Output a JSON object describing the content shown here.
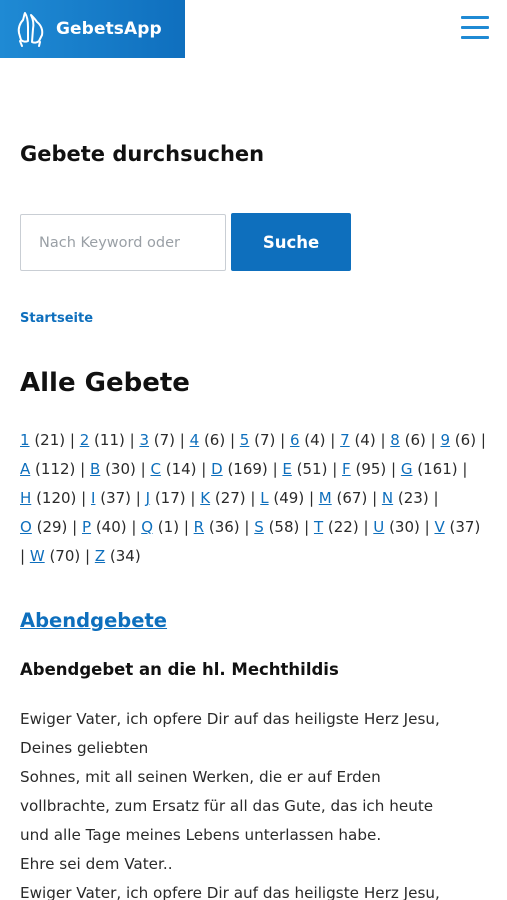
{
  "header": {
    "logo_text": "GebetsApp",
    "logo_icon": "praying-hands-icon",
    "menu_icon": "hamburger-menu-icon",
    "brand_color": "#1f8ad4"
  },
  "search": {
    "title": "Gebete durchsuchen",
    "placeholder": "Nach Keyword oder",
    "button_label": "Suche"
  },
  "breadcrumb": {
    "label": "Startseite"
  },
  "all_prayers": {
    "title": "Alle Gebete",
    "index": [
      {
        "letter": "1",
        "count": "(21)"
      },
      {
        "letter": "2",
        "count": "(11)"
      },
      {
        "letter": "3",
        "count": "(7)"
      },
      {
        "letter": "4",
        "count": "(6)"
      },
      {
        "letter": "5",
        "count": "(7)"
      },
      {
        "letter": "6",
        "count": "(4)"
      },
      {
        "letter": "7",
        "count": "(4)"
      },
      {
        "letter": "8",
        "count": "(6)"
      },
      {
        "letter": "9",
        "count": "(6)"
      },
      {
        "letter": "A",
        "count": "(112)"
      },
      {
        "letter": "B",
        "count": "(30)"
      },
      {
        "letter": "C",
        "count": "(14)"
      },
      {
        "letter": "D",
        "count": "(169)"
      },
      {
        "letter": "E",
        "count": "(51)"
      },
      {
        "letter": "F",
        "count": "(95)"
      },
      {
        "letter": "G",
        "count": "(161)"
      },
      {
        "letter": "H",
        "count": "(120)"
      },
      {
        "letter": "I",
        "count": "(37)"
      },
      {
        "letter": "J",
        "count": "(17)"
      },
      {
        "letter": "K",
        "count": "(27)"
      },
      {
        "letter": "L",
        "count": "(49)"
      },
      {
        "letter": "M",
        "count": "(67)"
      },
      {
        "letter": "N",
        "count": "(23)"
      },
      {
        "letter": "O",
        "count": "(29)"
      },
      {
        "letter": "P",
        "count": "(40)"
      },
      {
        "letter": "Q",
        "count": "(1)"
      },
      {
        "letter": "R",
        "count": "(36)"
      },
      {
        "letter": "S",
        "count": "(58)"
      },
      {
        "letter": "T",
        "count": "(22)"
      },
      {
        "letter": "U",
        "count": "(30)"
      },
      {
        "letter": "V",
        "count": "(37)"
      },
      {
        "letter": "W",
        "count": "(70)"
      },
      {
        "letter": "Z",
        "count": "(34)"
      }
    ]
  },
  "section": {
    "title": "Abendgebete",
    "prayer_title": "Abendgebet an die hl. Mechthildis",
    "prayer_lines": [
      "Ewiger Vater, ich opfere Dir auf das heiligste Herz Jesu,",
      "Deines geliebten",
      "Sohnes, mit all seinen Werken, die er auf Erden",
      "vollbrachte, zum Ersatz für all das Gute, das ich heute",
      "und alle Tage meines Lebens unterlassen habe.",
      "Ehre sei dem Vater..",
      "Ewiger Vater, ich opfere Dir auf das heiligste Herz Jesu,"
    ]
  }
}
